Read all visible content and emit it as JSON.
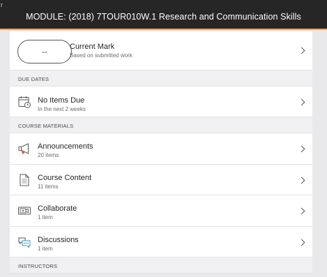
{
  "header": {
    "back_glyph": "r",
    "title": "MODULE: (2018) 7TOUR010W.1 Research and Communication Skills"
  },
  "current_mark": {
    "value": "--",
    "title": "Current Mark",
    "subtitle": "Based on submitted work"
  },
  "due_dates": {
    "section_label": "DUE DATES",
    "title": "No Items Due",
    "subtitle": "In the next 2 weeks",
    "icon": "calendar-clock-icon"
  },
  "course_materials": {
    "section_label": "COURSE MATERIALS",
    "items": [
      {
        "title": "Announcements",
        "subtitle": "20 items",
        "icon": "megaphone-icon"
      },
      {
        "title": "Course Content",
        "subtitle": "11 items",
        "icon": "document-icon"
      },
      {
        "title": "Collaborate",
        "subtitle": "1 item",
        "icon": "video-icon"
      },
      {
        "title": "Discussions",
        "subtitle": "1 item",
        "icon": "chat-bubbles-icon"
      }
    ]
  },
  "instructors": {
    "section_label": "INSTRUCTORS"
  },
  "colors": {
    "header_bg": "#262626",
    "header_accent": "#f0a35b",
    "page_bg": "#e9e8ea",
    "discussion_accent": "#3a9bb5"
  }
}
